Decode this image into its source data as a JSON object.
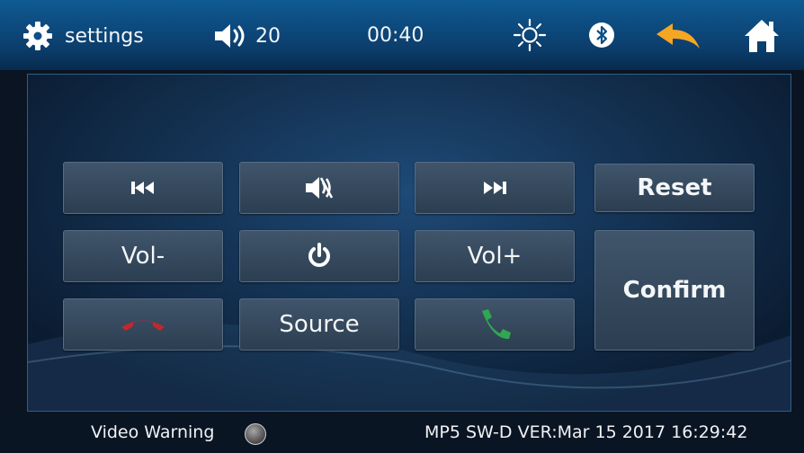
{
  "topbar": {
    "settings_label": "settings",
    "volume_value": "20",
    "clock": "00:40",
    "settings_icon": "gear-icon",
    "volume_icon": "speaker-icon",
    "brightness_icon": "sun-icon",
    "bluetooth_icon": "bluetooth-icon",
    "back_icon": "back-arrow-icon",
    "home_icon": "home-icon",
    "colors": {
      "bar": "#0f5a93",
      "back_arrow": "#f5a623"
    }
  },
  "controls": {
    "prev_icon": "skip-previous-icon",
    "mute_icon": "mute-icon",
    "next_icon": "skip-next-icon",
    "reset_label": "Reset",
    "vol_down_label": "Vol-",
    "power_icon": "power-icon",
    "vol_up_label": "Vol+",
    "confirm_label": "Confirm",
    "hangup_icon": "phone-hangup-icon",
    "source_label": "Source",
    "answer_icon": "phone-answer-icon",
    "colors": {
      "hangup": "#c0282d",
      "answer": "#2fa84f"
    }
  },
  "footer": {
    "video_warning_label": "Video Warning",
    "version_text": "MP5 SW-D VER:Mar 15 2017 16:29:42"
  }
}
